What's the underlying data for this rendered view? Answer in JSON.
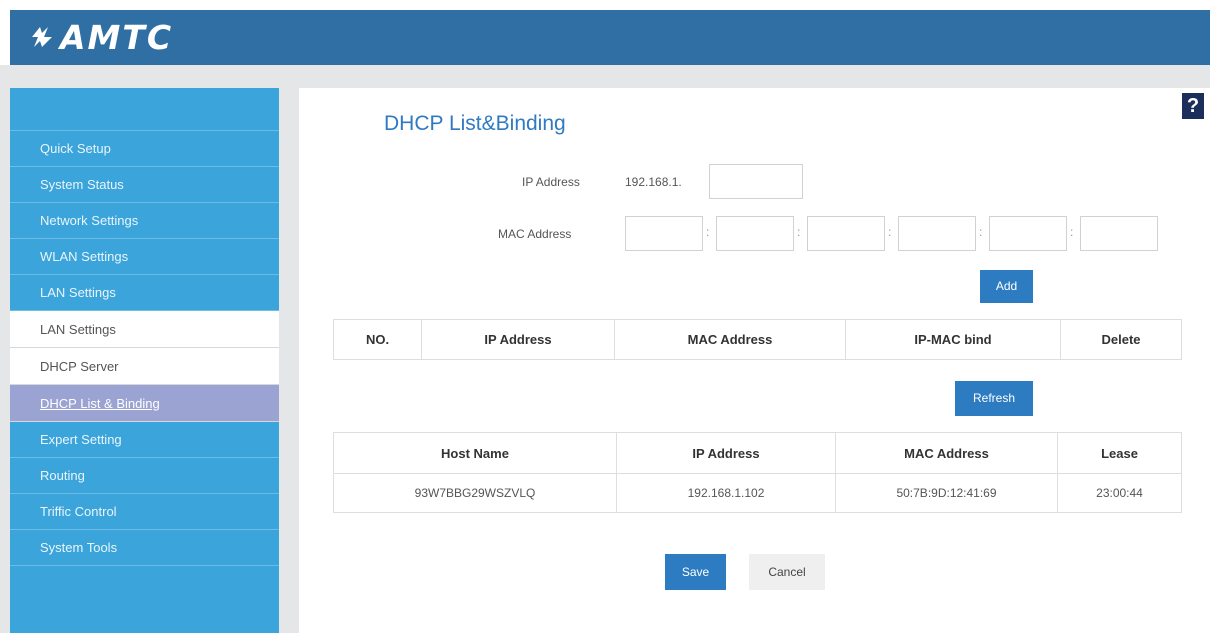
{
  "header": {
    "logo_text": "AMTC"
  },
  "sidebar": {
    "items": [
      {
        "label": "Quick Setup"
      },
      {
        "label": "System Status"
      },
      {
        "label": "Network Settings"
      },
      {
        "label": "WLAN Settings"
      },
      {
        "label": "LAN Settings"
      }
    ],
    "sub_items": [
      {
        "label": "LAN Settings"
      },
      {
        "label": "DHCP Server"
      },
      {
        "label": "DHCP List & Binding"
      }
    ],
    "items_after": [
      {
        "label": "Expert Setting"
      },
      {
        "label": "Routing"
      },
      {
        "label": "Triffic Control"
      },
      {
        "label": "System Tools"
      }
    ]
  },
  "help": {
    "label": "?"
  },
  "page": {
    "title": "DHCP List&Binding"
  },
  "form": {
    "ip_label": "IP Address",
    "ip_prefix": "192.168.1.",
    "ip_value": "",
    "mac_label": "MAC Address",
    "mac_values": [
      "",
      "",
      "",
      "",
      "",
      ""
    ],
    "mac_separator": ":",
    "add_label": "Add"
  },
  "binding_table": {
    "headers": [
      "NO.",
      "IP Address",
      "MAC Address",
      "IP-MAC bind",
      "Delete"
    ]
  },
  "refresh_label": "Refresh",
  "client_table": {
    "headers": [
      "Host Name",
      "IP Address",
      "MAC Address",
      "Lease"
    ],
    "rows": [
      [
        "93W7BBG29WSZVLQ",
        "192.168.1.102",
        "50:7B:9D:12:41:69",
        "23:00:44"
      ]
    ]
  },
  "footer": {
    "save_label": "Save",
    "cancel_label": "Cancel"
  },
  "colors": {
    "header": "#2f6fa3",
    "sidebar": "#3aa4db",
    "active": "#9aa3d2",
    "button": "#2d7cc1",
    "title": "#2f7ac0"
  }
}
